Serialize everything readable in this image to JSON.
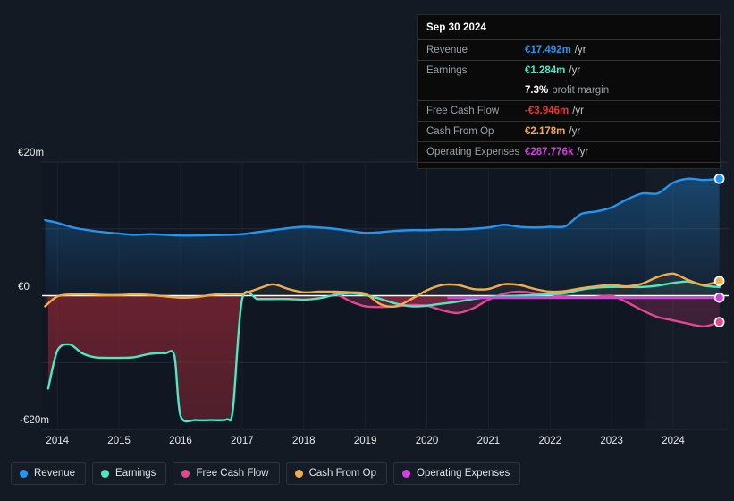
{
  "theme": {
    "background": "#141a23",
    "plot_background": "#101722",
    "grid_color": "#2c3440",
    "zero_line_color": "#ffffff",
    "axis_text_color": "#e8eaed"
  },
  "axes": {
    "y_ticks": [
      {
        "label": "€20m",
        "value": 20
      },
      {
        "label": "€0",
        "value": 0
      },
      {
        "label": "-€20m",
        "value": -20
      }
    ],
    "y_min": -20,
    "y_max": 20,
    "x_ticks": [
      "2014",
      "2015",
      "2016",
      "2017",
      "2018",
      "2019",
      "2020",
      "2021",
      "2022",
      "2023",
      "2024"
    ]
  },
  "tooltip": {
    "date": "Sep 30 2024",
    "rows": [
      {
        "key": "Revenue",
        "value": "€17.492m",
        "suffix": "/yr",
        "color": "#2196f3"
      },
      {
        "key": "Earnings",
        "value": "€1.284m",
        "suffix": "/yr",
        "color": "#4de8c2"
      },
      {
        "key": "",
        "value": "7.3%",
        "suffix": "profit margin",
        "color": "#ffffff"
      },
      {
        "key": "Free Cash Flow",
        "value": "-€3.946m",
        "suffix": "/yr",
        "color": "#e53935"
      },
      {
        "key": "Cash From Op",
        "value": "€2.178m",
        "suffix": "/yr",
        "color": "#f0ad4e"
      },
      {
        "key": "Operating Expenses",
        "value": "€287.776k",
        "suffix": "/yr",
        "color": "#cc44dd"
      }
    ]
  },
  "legend": {
    "items": [
      {
        "label": "Revenue",
        "color": "#2196f3"
      },
      {
        "label": "Earnings",
        "color": "#4de8c2"
      },
      {
        "label": "Free Cash Flow",
        "color": "#e0488f"
      },
      {
        "label": "Cash From Op",
        "color": "#f0ad4e"
      },
      {
        "label": "Operating Expenses",
        "color": "#cc44dd"
      }
    ]
  },
  "chart_data": {
    "type": "area",
    "title": "",
    "xlabel": "",
    "ylabel": "",
    "ylim": [
      -20,
      20
    ],
    "x_unit": "year",
    "x_range": [
      2013.75,
      2024.9
    ],
    "grid": true,
    "legend_position": "bottom-left",
    "annotations": [
      {
        "type": "highlight-band",
        "from": 2023.55,
        "to": 2024.9,
        "note": "forecast / recent period shading"
      },
      {
        "type": "endpoint-markers",
        "at": 2024.75,
        "note": "circle markers on last value of each series"
      }
    ],
    "series": [
      {
        "name": "Revenue",
        "color": "#2196f3",
        "fill": true,
        "x": [
          2013.8,
          2014.0,
          2014.25,
          2014.5,
          2014.75,
          2015.0,
          2015.25,
          2015.5,
          2015.75,
          2016.0,
          2016.25,
          2016.5,
          2016.75,
          2017.0,
          2017.25,
          2017.5,
          2017.75,
          2018.0,
          2018.25,
          2018.5,
          2018.75,
          2019.0,
          2019.25,
          2019.5,
          2019.75,
          2020.0,
          2020.25,
          2020.5,
          2020.75,
          2021.0,
          2021.25,
          2021.5,
          2021.75,
          2022.0,
          2022.25,
          2022.5,
          2022.75,
          2023.0,
          2023.25,
          2023.5,
          2023.75,
          2024.0,
          2024.25,
          2024.5,
          2024.75
        ],
        "y": [
          11.3,
          10.9,
          10.2,
          9.8,
          9.5,
          9.3,
          9.1,
          9.2,
          9.1,
          9.0,
          9.0,
          9.05,
          9.1,
          9.2,
          9.5,
          9.8,
          10.1,
          10.3,
          10.2,
          10.0,
          9.7,
          9.4,
          9.5,
          9.7,
          9.8,
          9.8,
          9.9,
          9.9,
          10.0,
          10.2,
          10.6,
          10.3,
          10.2,
          10.3,
          10.4,
          12.2,
          12.6,
          13.2,
          14.4,
          15.3,
          15.3,
          16.9,
          17.5,
          17.3,
          17.49
        ]
      },
      {
        "name": "Earnings",
        "color": "#4de8c2",
        "fill": true,
        "x": [
          2013.85,
          2014.0,
          2014.2,
          2014.4,
          2014.6,
          2014.8,
          2015.0,
          2015.25,
          2015.5,
          2015.75,
          2015.9,
          2016.0,
          2016.25,
          2016.5,
          2016.75,
          2016.85,
          2017.0,
          2017.25,
          2017.5,
          2017.75,
          2018.0,
          2018.25,
          2018.5,
          2018.75,
          2019.0,
          2019.25,
          2019.5,
          2019.75,
          2020.0,
          2020.25,
          2020.5,
          2020.75,
          2021.0,
          2021.25,
          2021.5,
          2021.75,
          2022.0,
          2022.25,
          2022.5,
          2022.75,
          2023.0,
          2023.25,
          2023.5,
          2023.75,
          2024.0,
          2024.25,
          2024.5,
          2024.75
        ],
        "y": [
          -13.9,
          -8.2,
          -7.3,
          -8.6,
          -9.2,
          -9.3,
          -9.3,
          -9.2,
          -8.7,
          -8.6,
          -9.0,
          -18.0,
          -18.6,
          -18.6,
          -18.5,
          -17.0,
          -0.5,
          -0.5,
          -0.5,
          -0.5,
          -0.6,
          -0.4,
          0.1,
          0.4,
          0.1,
          -0.5,
          -1.2,
          -1.6,
          -1.5,
          -1.2,
          -0.9,
          -0.5,
          -0.2,
          -0.1,
          0.0,
          0.1,
          0.2,
          0.4,
          0.9,
          1.2,
          1.3,
          1.3,
          1.3,
          1.5,
          1.9,
          2.1,
          1.5,
          1.28
        ]
      },
      {
        "name": "Free Cash Flow",
        "color": "#e0488f",
        "fill": true,
        "x": [
          2018.45,
          2018.6,
          2018.8,
          2019.0,
          2019.25,
          2019.5,
          2019.75,
          2020.0,
          2020.25,
          2020.5,
          2020.75,
          2021.0,
          2021.25,
          2021.5,
          2021.75,
          2022.0,
          2022.25,
          2022.5,
          2022.75,
          2023.0,
          2023.25,
          2023.5,
          2023.75,
          2024.0,
          2024.25,
          2024.5,
          2024.75
        ],
        "y": [
          0.5,
          -0.1,
          -1.0,
          -1.6,
          -1.7,
          -1.6,
          -1.4,
          -1.5,
          -2.2,
          -2.6,
          -1.9,
          -0.6,
          0.3,
          0.6,
          0.4,
          0.2,
          -0.1,
          -0.3,
          -0.2,
          0.0,
          -1.0,
          -2.2,
          -3.2,
          -3.7,
          -4.2,
          -4.6,
          -3.95
        ]
      },
      {
        "name": "Cash From Op",
        "color": "#f0ad4e",
        "fill": true,
        "x": [
          2013.8,
          2014.0,
          2014.25,
          2014.5,
          2014.75,
          2015.0,
          2015.25,
          2015.5,
          2015.75,
          2016.0,
          2016.25,
          2016.5,
          2016.75,
          2017.0,
          2017.25,
          2017.5,
          2017.75,
          2018.0,
          2018.25,
          2018.5,
          2018.75,
          2019.0,
          2019.25,
          2019.5,
          2019.75,
          2020.0,
          2020.25,
          2020.5,
          2020.75,
          2021.0,
          2021.25,
          2021.5,
          2021.75,
          2022.0,
          2022.25,
          2022.5,
          2022.75,
          2023.0,
          2023.25,
          2023.5,
          2023.75,
          2024.0,
          2024.25,
          2024.5,
          2024.75
        ],
        "y": [
          -1.6,
          -0.1,
          0.2,
          0.2,
          0.1,
          0.1,
          0.2,
          0.1,
          -0.1,
          -0.3,
          -0.2,
          0.1,
          0.3,
          0.3,
          1.0,
          1.7,
          1.0,
          0.5,
          0.6,
          0.6,
          0.5,
          0.3,
          -1.3,
          -1.6,
          -0.5,
          0.8,
          1.6,
          1.6,
          1.0,
          1.0,
          1.7,
          1.6,
          1.0,
          0.6,
          0.7,
          1.1,
          1.4,
          1.6,
          1.4,
          1.8,
          2.8,
          3.3,
          2.3,
          1.6,
          2.18
        ]
      },
      {
        "name": "Operating Expenses",
        "color": "#cc44dd",
        "fill": false,
        "x": [
          2020.35,
          2021.0,
          2022.0,
          2023.0,
          2024.0,
          2024.75
        ],
        "y": [
          -0.3,
          -0.3,
          -0.3,
          -0.3,
          -0.3,
          -0.29
        ]
      }
    ]
  }
}
